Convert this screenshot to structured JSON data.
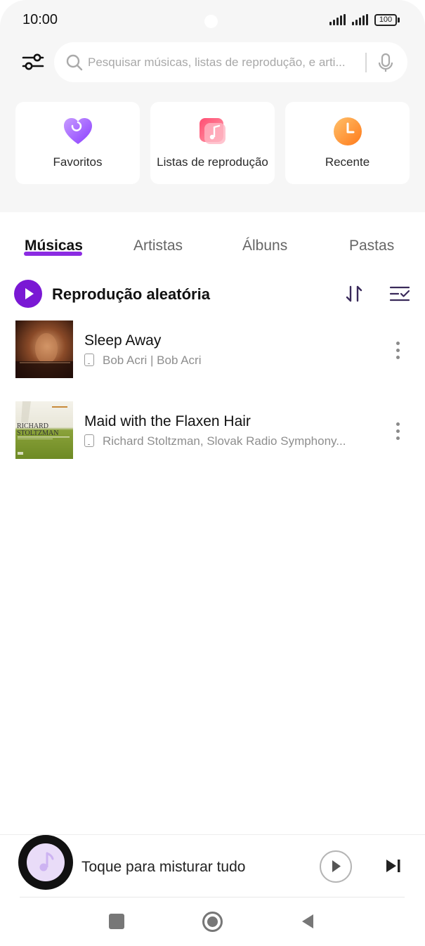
{
  "status_bar": {
    "time": "10:00",
    "battery": "100"
  },
  "search": {
    "placeholder": "Pesquisar músicas, listas de reprodução, e arti..."
  },
  "quick_access": [
    {
      "label": "Favoritos",
      "icon": "heart-icon",
      "color": "#9b4dff"
    },
    {
      "label": "Listas de reprodução",
      "icon": "playlist-icon",
      "color": "#ff5d7a"
    },
    {
      "label": "Recente",
      "icon": "clock-icon",
      "color": "#ff8a1f"
    }
  ],
  "tabs": [
    {
      "label": "Músicas",
      "active": true
    },
    {
      "label": "Artistas",
      "active": false
    },
    {
      "label": "Álbuns",
      "active": false
    },
    {
      "label": "Pastas",
      "active": false
    }
  ],
  "shuffle": {
    "label": "Reprodução aleatória"
  },
  "songs": [
    {
      "title": "Sleep Away",
      "artist": "Bob Acri | Bob Acri",
      "cover": "sleep-away-cover"
    },
    {
      "title": "Maid with the Flaxen Hair",
      "artist": "Richard Stoltzman, Slovak Radio Symphony...",
      "cover": "maid-flaxen-hair-cover",
      "cover_text_1": "RICHARD",
      "cover_text_2": "STOLTZMAN"
    }
  ],
  "mini_player": {
    "label": "Toque para misturar tudo"
  },
  "colors": {
    "accent": "#7a18d4",
    "tab_underline": "#8b2be2",
    "top_background": "#f6f6f6"
  }
}
